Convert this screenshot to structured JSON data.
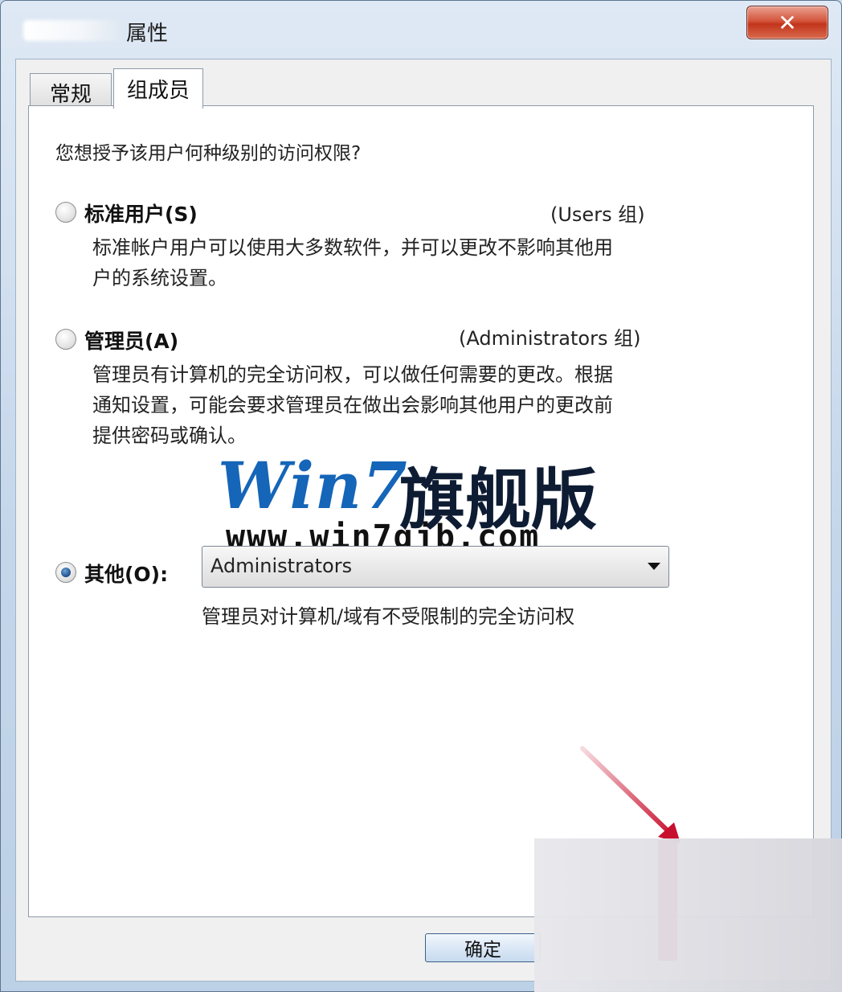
{
  "window": {
    "title": "属性",
    "close_glyph": "✕"
  },
  "tabs": [
    {
      "label": "常规",
      "active": false
    },
    {
      "label": "组成员",
      "active": true
    }
  ],
  "question": "您想授予该用户何种级别的访问权限?",
  "options": [
    {
      "label": "标准用户(S)",
      "group": "(Users 组)",
      "checked": false,
      "description": [
        "标准帐户用户可以使用大多数软件，并可以更改不影响其他用",
        "户的系统设置。"
      ]
    },
    {
      "label": "管理员(A)",
      "group": "(Administrators 组)",
      "checked": false,
      "description": [
        "管理员有计算机的完全访问权，可以做任何需要的更改。根据",
        "通知设置，可能会要求管理员在做出会影响其他用户的更改前",
        "提供密码或确认。"
      ]
    },
    {
      "label": "其他(O):",
      "checked": true
    }
  ],
  "other_select": {
    "value": "Administrators",
    "description": "管理员对计算机/域有不受限制的完全访问权"
  },
  "watermark": {
    "logo": "Win7",
    "cn": "旗舰版",
    "url": "www.win7qjb.com"
  },
  "buttons": {
    "ok": "确定"
  },
  "colors": {
    "accent_red": "#c8102e",
    "selected_radio": "#1f4e8a",
    "watermark_blue": "#1565b8"
  }
}
